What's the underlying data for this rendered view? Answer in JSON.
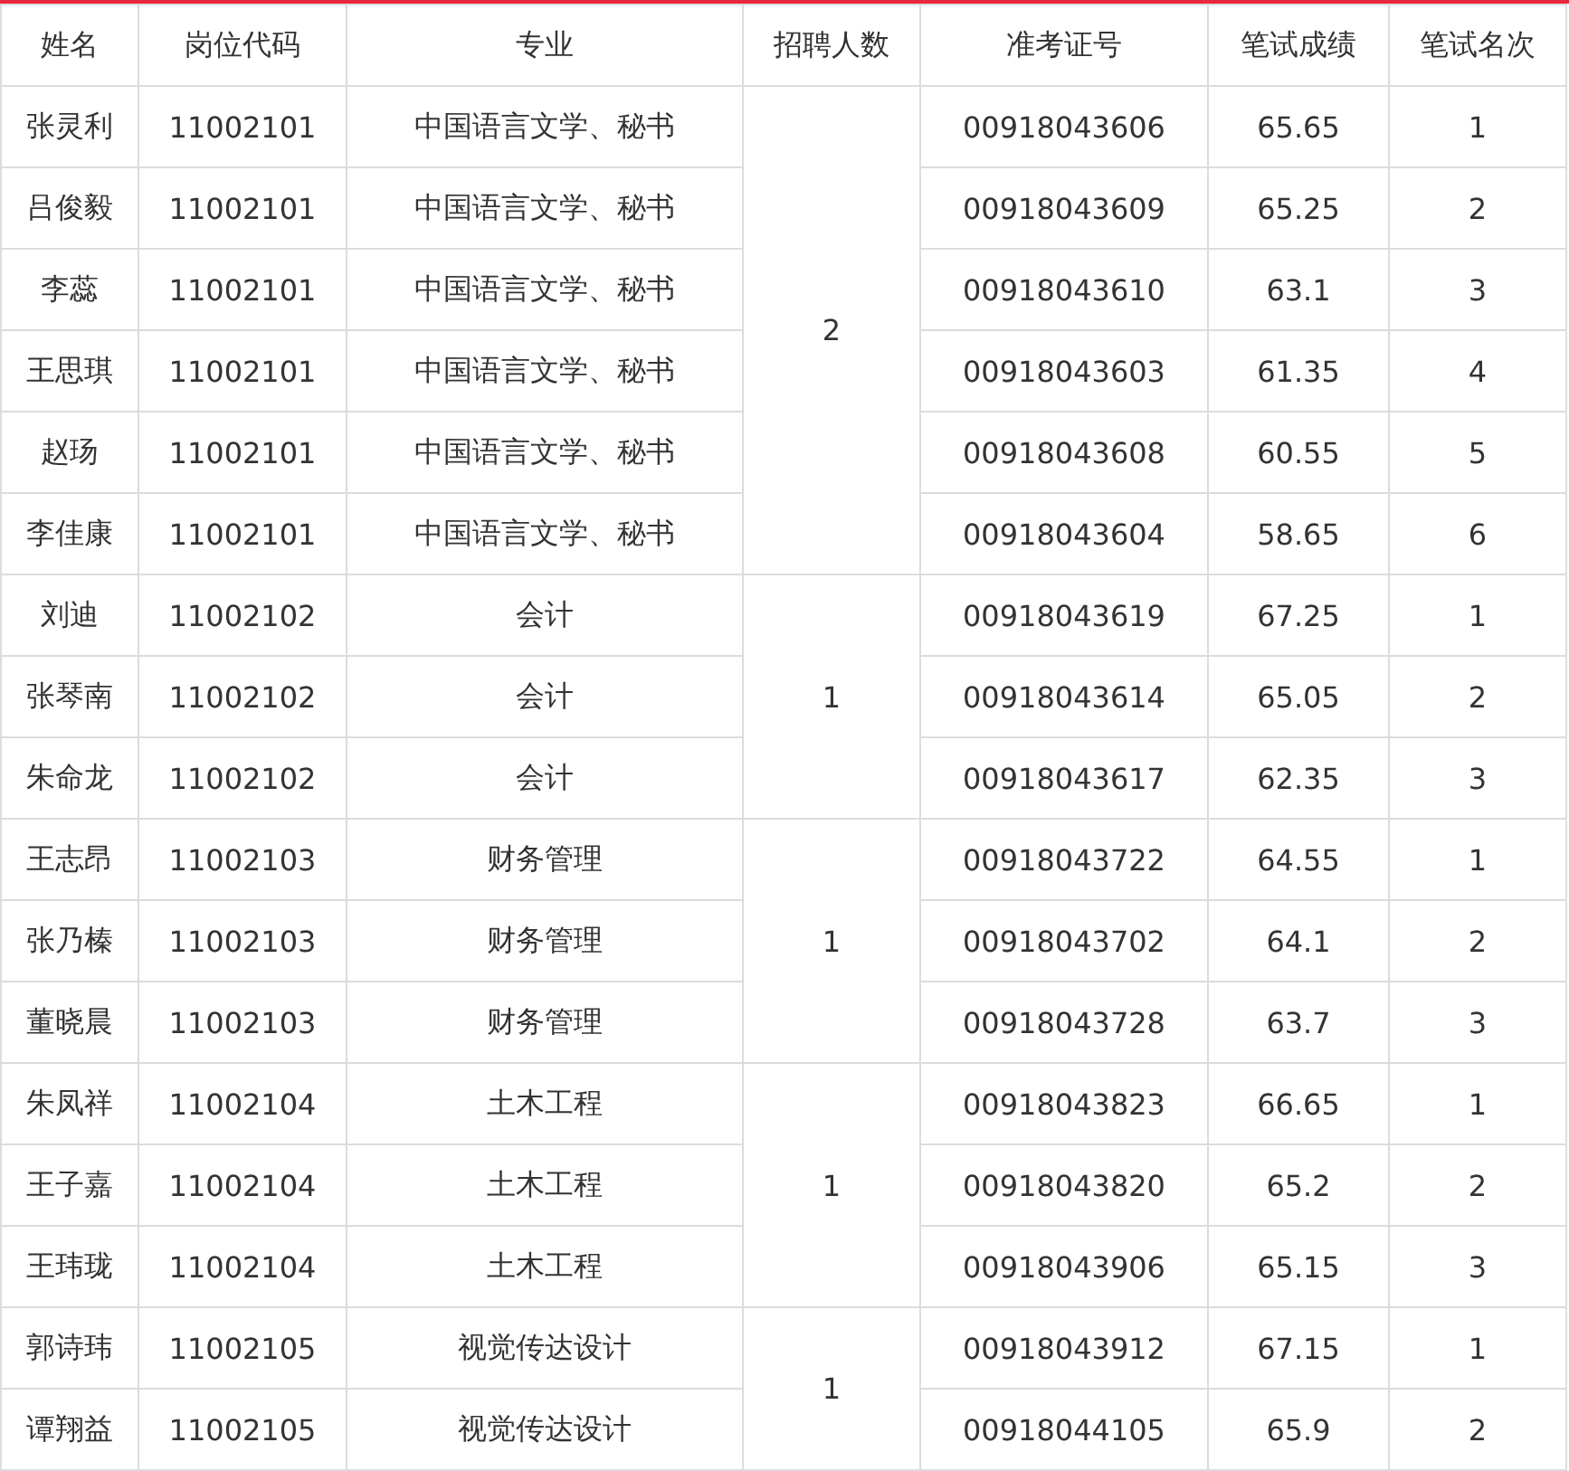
{
  "table": {
    "columns": [
      "姓名",
      "岗位代码",
      "专业",
      "招聘人数",
      "准考证号",
      "笔试成绩",
      "笔试名次"
    ],
    "groups": [
      {
        "openings": "2",
        "rows": [
          {
            "name": "张灵利",
            "code": "11002101",
            "major": "中国语言文学、秘书",
            "ticket": "00918043606",
            "score": "65.65",
            "rank": "1"
          },
          {
            "name": "吕俊毅",
            "code": "11002101",
            "major": "中国语言文学、秘书",
            "ticket": "00918043609",
            "score": "65.25",
            "rank": "2"
          },
          {
            "name": "李蕊",
            "code": "11002101",
            "major": "中国语言文学、秘书",
            "ticket": "00918043610",
            "score": "63.1",
            "rank": "3"
          },
          {
            "name": "王思琪",
            "code": "11002101",
            "major": "中国语言文学、秘书",
            "ticket": "00918043603",
            "score": "61.35",
            "rank": "4"
          },
          {
            "name": "赵玚",
            "code": "11002101",
            "major": "中国语言文学、秘书",
            "ticket": "00918043608",
            "score": "60.55",
            "rank": "5"
          },
          {
            "name": "李佳康",
            "code": "11002101",
            "major": "中国语言文学、秘书",
            "ticket": "00918043604",
            "score": "58.65",
            "rank": "6"
          }
        ]
      },
      {
        "openings": "1",
        "rows": [
          {
            "name": "刘迪",
            "code": "11002102",
            "major": "会计",
            "ticket": "00918043619",
            "score": "67.25",
            "rank": "1"
          },
          {
            "name": "张琴南",
            "code": "11002102",
            "major": "会计",
            "ticket": "00918043614",
            "score": "65.05",
            "rank": "2"
          },
          {
            "name": "朱命龙",
            "code": "11002102",
            "major": "会计",
            "ticket": "00918043617",
            "score": "62.35",
            "rank": "3"
          }
        ]
      },
      {
        "openings": "1",
        "rows": [
          {
            "name": "王志昂",
            "code": "11002103",
            "major": "财务管理",
            "ticket": "00918043722",
            "score": "64.55",
            "rank": "1"
          },
          {
            "name": "张乃榛",
            "code": "11002103",
            "major": "财务管理",
            "ticket": "00918043702",
            "score": "64.1",
            "rank": "2"
          },
          {
            "name": "董晓晨",
            "code": "11002103",
            "major": "财务管理",
            "ticket": "00918043728",
            "score": "63.7",
            "rank": "3"
          }
        ]
      },
      {
        "openings": "1",
        "rows": [
          {
            "name": "朱凤祥",
            "code": "11002104",
            "major": "土木工程",
            "ticket": "00918043823",
            "score": "66.65",
            "rank": "1"
          },
          {
            "name": "王子嘉",
            "code": "11002104",
            "major": "土木工程",
            "ticket": "00918043820",
            "score": "65.2",
            "rank": "2"
          },
          {
            "name": "王玮珑",
            "code": "11002104",
            "major": "土木工程",
            "ticket": "00918043906",
            "score": "65.15",
            "rank": "3"
          }
        ]
      },
      {
        "openings": "1",
        "rows": [
          {
            "name": "郭诗玮",
            "code": "11002105",
            "major": "视觉传达设计",
            "ticket": "00918043912",
            "score": "67.15",
            "rank": "1"
          },
          {
            "name": "谭翔益",
            "code": "11002105",
            "major": "视觉传达设计",
            "ticket": "00918044105",
            "score": "65.9",
            "rank": "2"
          }
        ]
      }
    ]
  }
}
